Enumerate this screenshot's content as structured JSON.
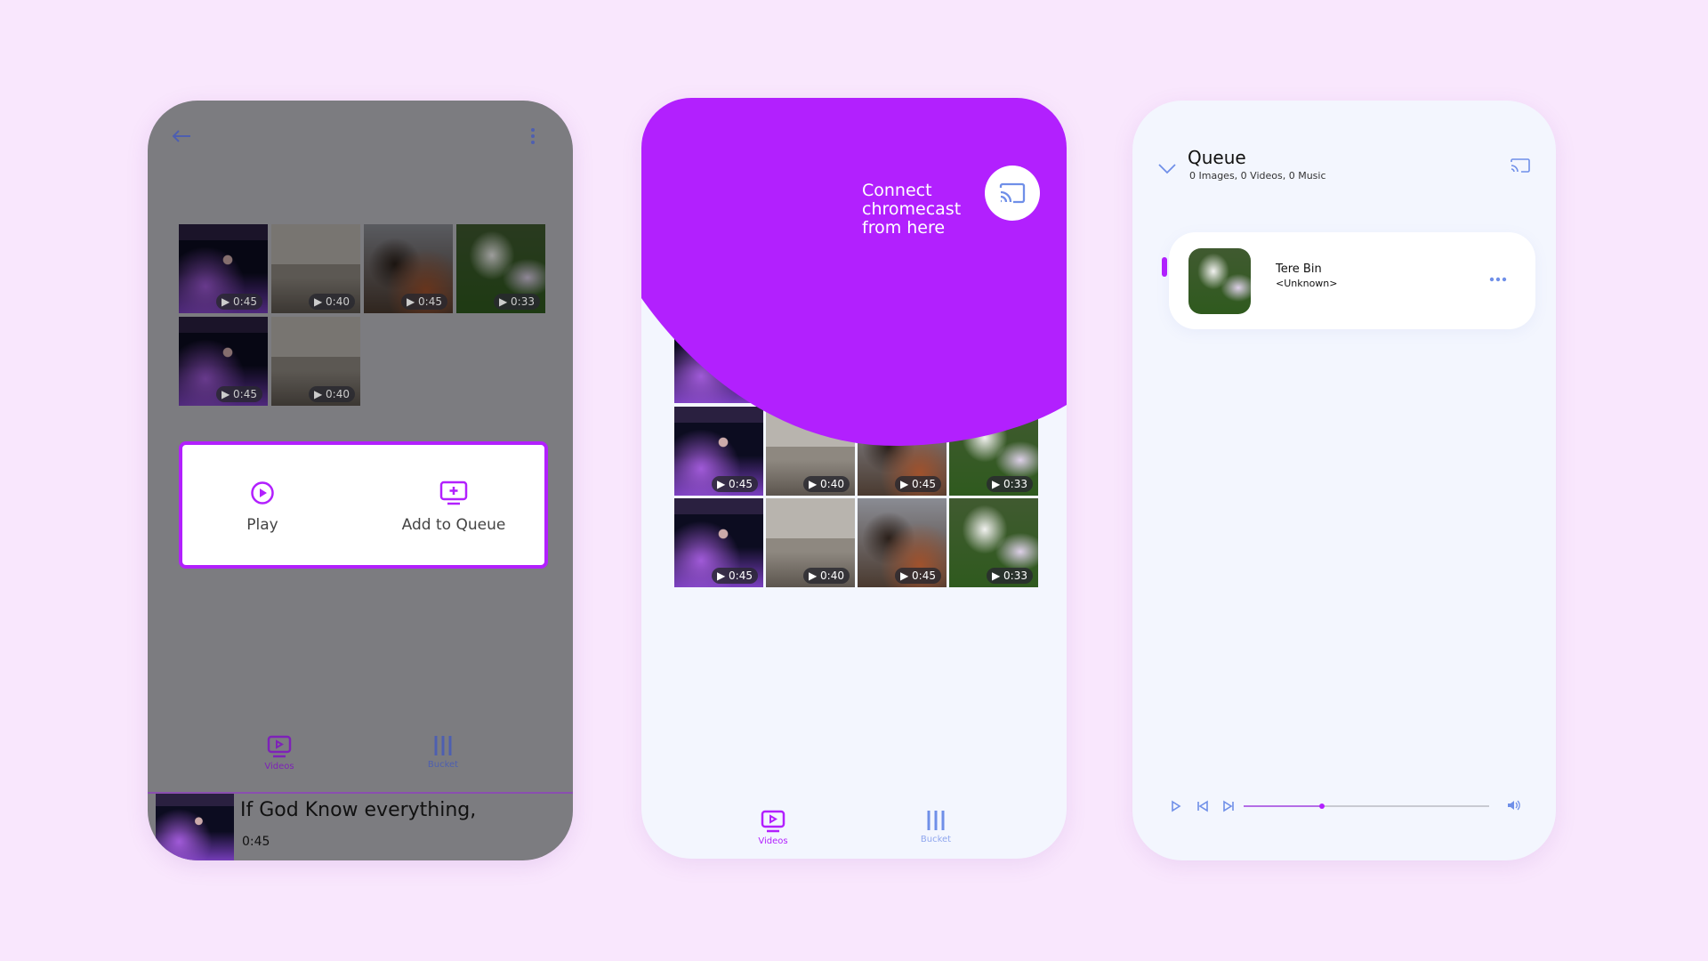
{
  "colors": {
    "accent": "#b220fe",
    "icon_blue": "#6f8fe8",
    "background": "#f9e7fd"
  },
  "screen1": {
    "back_icon": "arrow-left-icon",
    "menu_icon": "more-vertical-icon",
    "grid": [
      {
        "duration": "0:45",
        "image": "concert"
      },
      {
        "duration": "0:40",
        "image": "beach"
      },
      {
        "duration": "0:45",
        "image": "couple"
      },
      {
        "duration": "0:33",
        "image": "goat"
      },
      {
        "duration": "0:45",
        "image": "concert"
      },
      {
        "duration": "0:40",
        "image": "beach"
      }
    ],
    "actions": {
      "play": "Play",
      "add_to_queue": "Add to Queue"
    },
    "nav": {
      "videos": "Videos",
      "bucket": "Bucket"
    },
    "now_playing": {
      "title": "If God Know everything,",
      "duration": "0:45"
    }
  },
  "screen2": {
    "connect_text": "Connect chromecast from here",
    "grid": [
      {
        "duration": "0:45",
        "image": "concert"
      },
      {
        "duration": "0:40",
        "image": "beach"
      },
      {
        "duration": "0:45",
        "image": "couple"
      },
      {
        "duration": "0:33",
        "image": "goat"
      },
      {
        "duration": "0:45",
        "image": "concert"
      },
      {
        "duration": "0:40",
        "image": "beach"
      },
      {
        "duration": "0:45",
        "image": "couple"
      },
      {
        "duration": "0:33",
        "image": "goat"
      }
    ],
    "nav": {
      "videos": "Videos",
      "bucket": "Bucket"
    }
  },
  "screen3": {
    "title": "Queue",
    "subtitle": "0 Images, 0 Videos, 0 Music",
    "item": {
      "title": "Tere Bin",
      "artist": "<Unknown>"
    },
    "progress": 0.32
  }
}
